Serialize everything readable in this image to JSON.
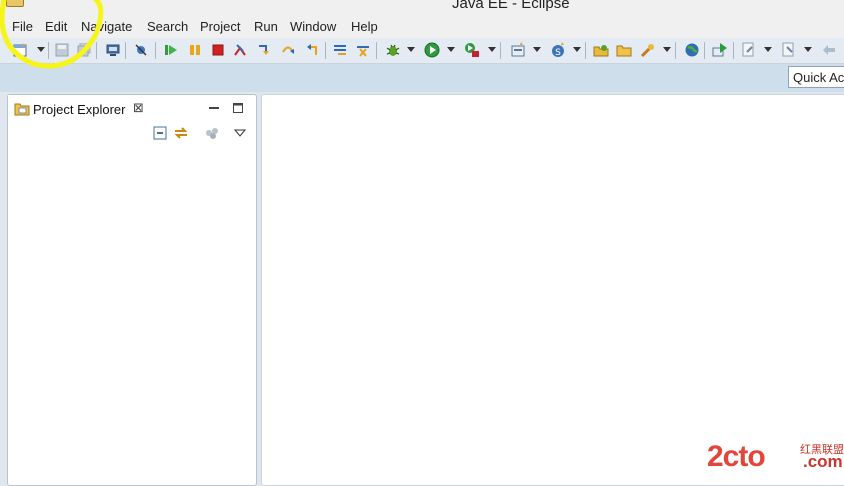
{
  "window": {
    "title": "Java EE - Eclipse"
  },
  "menubar": {
    "items": [
      {
        "label": "File"
      },
      {
        "label": "Edit"
      },
      {
        "label": "Navigate"
      },
      {
        "label": "Search"
      },
      {
        "label": "Project"
      },
      {
        "label": "Run"
      },
      {
        "label": "Window"
      },
      {
        "label": "Help"
      }
    ]
  },
  "toolbar": {
    "icons": [
      "new-icon",
      "save-icon",
      "save-all-icon",
      "print-icon",
      "skip-breakpoints-icon",
      "resume-icon",
      "suspend-icon",
      "terminate-icon",
      "disconnect-icon",
      "step-into-icon",
      "step-over-icon",
      "step-return-icon",
      "use-step-filters-icon",
      "drop-to-frame-icon",
      "debug-icon",
      "run-icon",
      "run-external-tool-icon",
      "new-server-icon",
      "new-web-service-icon",
      "open-type-icon",
      "open-task-icon",
      "search-icon",
      "open-web-browser-icon",
      "run-on-server-icon",
      "next-annotation-icon",
      "previous-annotation-icon",
      "back-icon"
    ]
  },
  "quick_access": {
    "placeholder": "Quick Access"
  },
  "project_explorer": {
    "tab_label": "Project Explorer",
    "close_glyph": "⊠",
    "view_icons": [
      "collapse-all-icon",
      "link-with-editor-icon",
      "focus-icon",
      "view-menu-icon"
    ]
  },
  "annotation": {
    "color": "#f5f51a"
  },
  "watermark": {
    "main": "2cto",
    "cn": "红黑联盟",
    "domain": ".com",
    "color": "#e2463a"
  }
}
